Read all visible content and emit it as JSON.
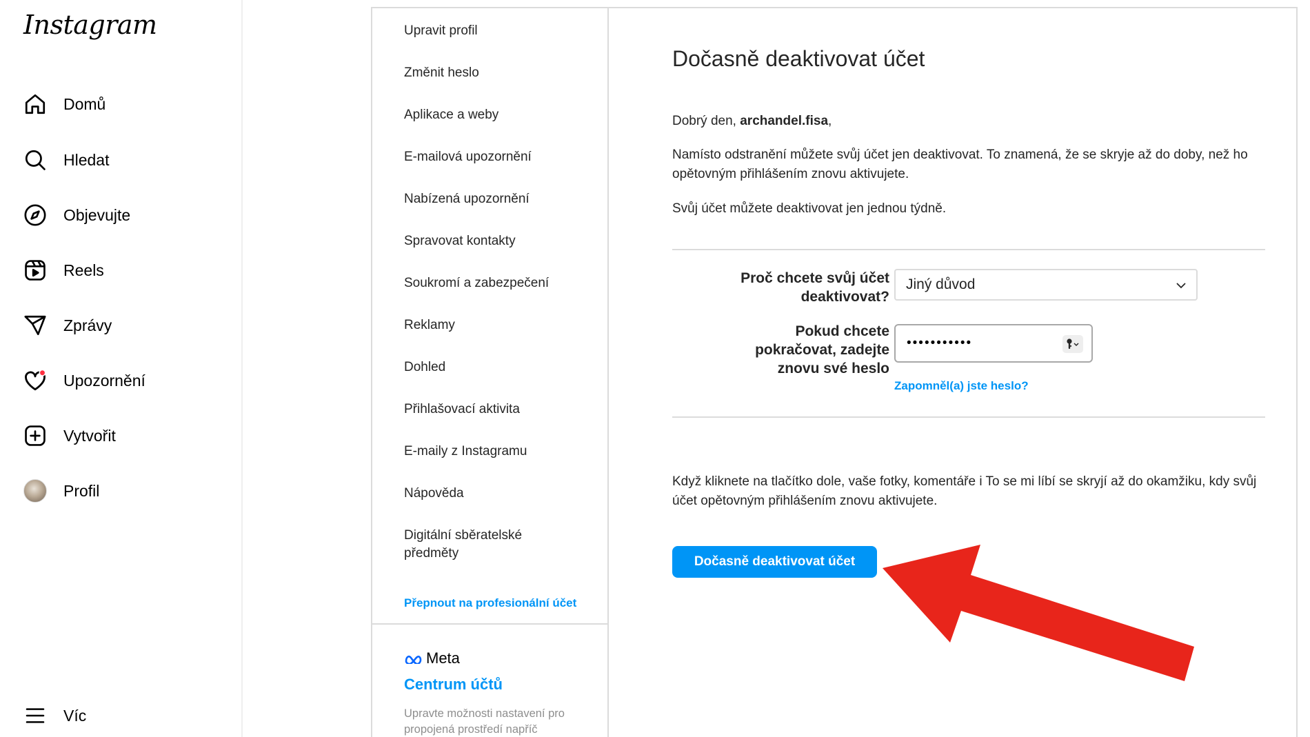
{
  "brand": {
    "logo_text": "Instagram"
  },
  "nav": {
    "items": [
      {
        "label": "Domů",
        "icon": "home-icon"
      },
      {
        "label": "Hledat",
        "icon": "search-icon"
      },
      {
        "label": "Objevujte",
        "icon": "compass-icon"
      },
      {
        "label": "Reels",
        "icon": "reels-icon"
      },
      {
        "label": "Zprávy",
        "icon": "paper-plane-icon"
      },
      {
        "label": "Upozornění",
        "icon": "heart-icon"
      },
      {
        "label": "Vytvořit",
        "icon": "plus-square-icon"
      },
      {
        "label": "Profil",
        "icon": "avatar"
      }
    ],
    "more_label": "Víc"
  },
  "settings_menu": {
    "items": [
      "Upravit profil",
      "Změnit heslo",
      "Aplikace a weby",
      "E-mailová upozornění",
      "Nabízená upozornění",
      "Spravovat kontakty",
      "Soukromí a zabezpečení",
      "Reklamy",
      "Dohled",
      "Přihlašovací aktivita",
      "E-maily z Instagramu",
      "Nápověda",
      "Digitální sběratelské předměty"
    ],
    "switch_pro_label": "Přepnout na profesionální účet",
    "meta": {
      "logo_text": "Meta",
      "accounts_center_label": "Centrum účtů",
      "description": "Upravte možnosti nastavení pro propojená prostředí napříč Instagramem, Facebook aplikací"
    }
  },
  "main": {
    "title": "Dočasně deaktivovat účet",
    "greeting_prefix": "Dobrý den, ",
    "username": "archandel.fisa",
    "greeting_suffix": ",",
    "paragraph1": "Namísto odstranění můžete svůj účet jen deaktivovat. To znamená, že se skryje až do doby, než ho opětovným přihlášením znovu aktivujete.",
    "paragraph2": "Svůj účet můžete deaktivovat jen jednou týdně.",
    "reason_label": "Proč chcete svůj účet deaktivovat?",
    "reason_value": "Jiný důvod",
    "password_label": "Pokud chcete pokračovat, zadejte znovu své heslo",
    "password_value": "•••••••••••",
    "forgot_label": "Zapomněl(a) jste heslo?",
    "notice": "Když kliknete na tlačítko dole, vaše fotky, komentáře i To se mi líbí se skryjí až do okamžiku, kdy svůj účet opětovným přihlášením znovu aktivujete.",
    "deactivate_button": "Dočasně deaktivovat účet"
  },
  "colors": {
    "accent_blue": "#0095f6",
    "notification_dot": "#ff3040",
    "annotation_arrow": "#e8251b"
  }
}
